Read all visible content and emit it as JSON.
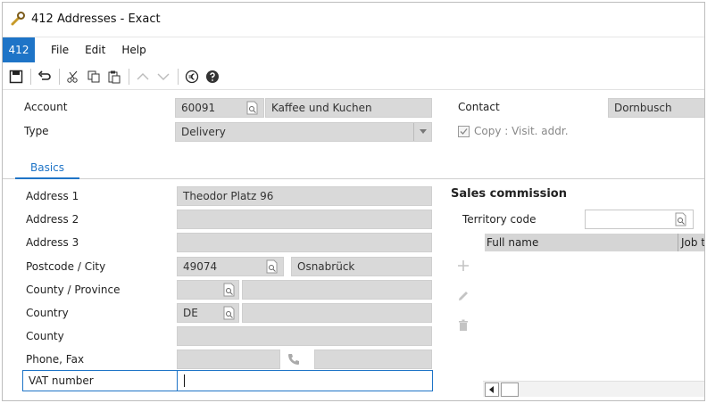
{
  "window": {
    "title": "412 Addresses - Exact"
  },
  "menubar": {
    "badge": "412",
    "items": [
      "File",
      "Edit",
      "Help"
    ]
  },
  "header": {
    "account_label": "Account",
    "account_code": "60091",
    "account_name": "Kaffee und Kuchen",
    "type_label": "Type",
    "type_value": "Delivery",
    "contact_label": "Contact",
    "contact_value": "Dornbusch",
    "copy_label": "Copy : Visit. addr."
  },
  "tabs": [
    {
      "label": "Basics"
    }
  ],
  "address": {
    "address1_label": "Address 1",
    "address1_value": "Theodor Platz 96",
    "address2_label": "Address 2",
    "address3_label": "Address 3",
    "postcode_label": "Postcode / City",
    "postcode_value": "49074",
    "city_value": "Osnabrück",
    "county_province_label": "County / Province",
    "country_label": "Country",
    "country_value": "DE",
    "county_label": "County",
    "phone_fax_label": "Phone, Fax",
    "vat_label": "VAT number"
  },
  "sales": {
    "title": "Sales commission",
    "territory_label": "Territory code",
    "columns": [
      "Full name",
      "Job t"
    ]
  }
}
